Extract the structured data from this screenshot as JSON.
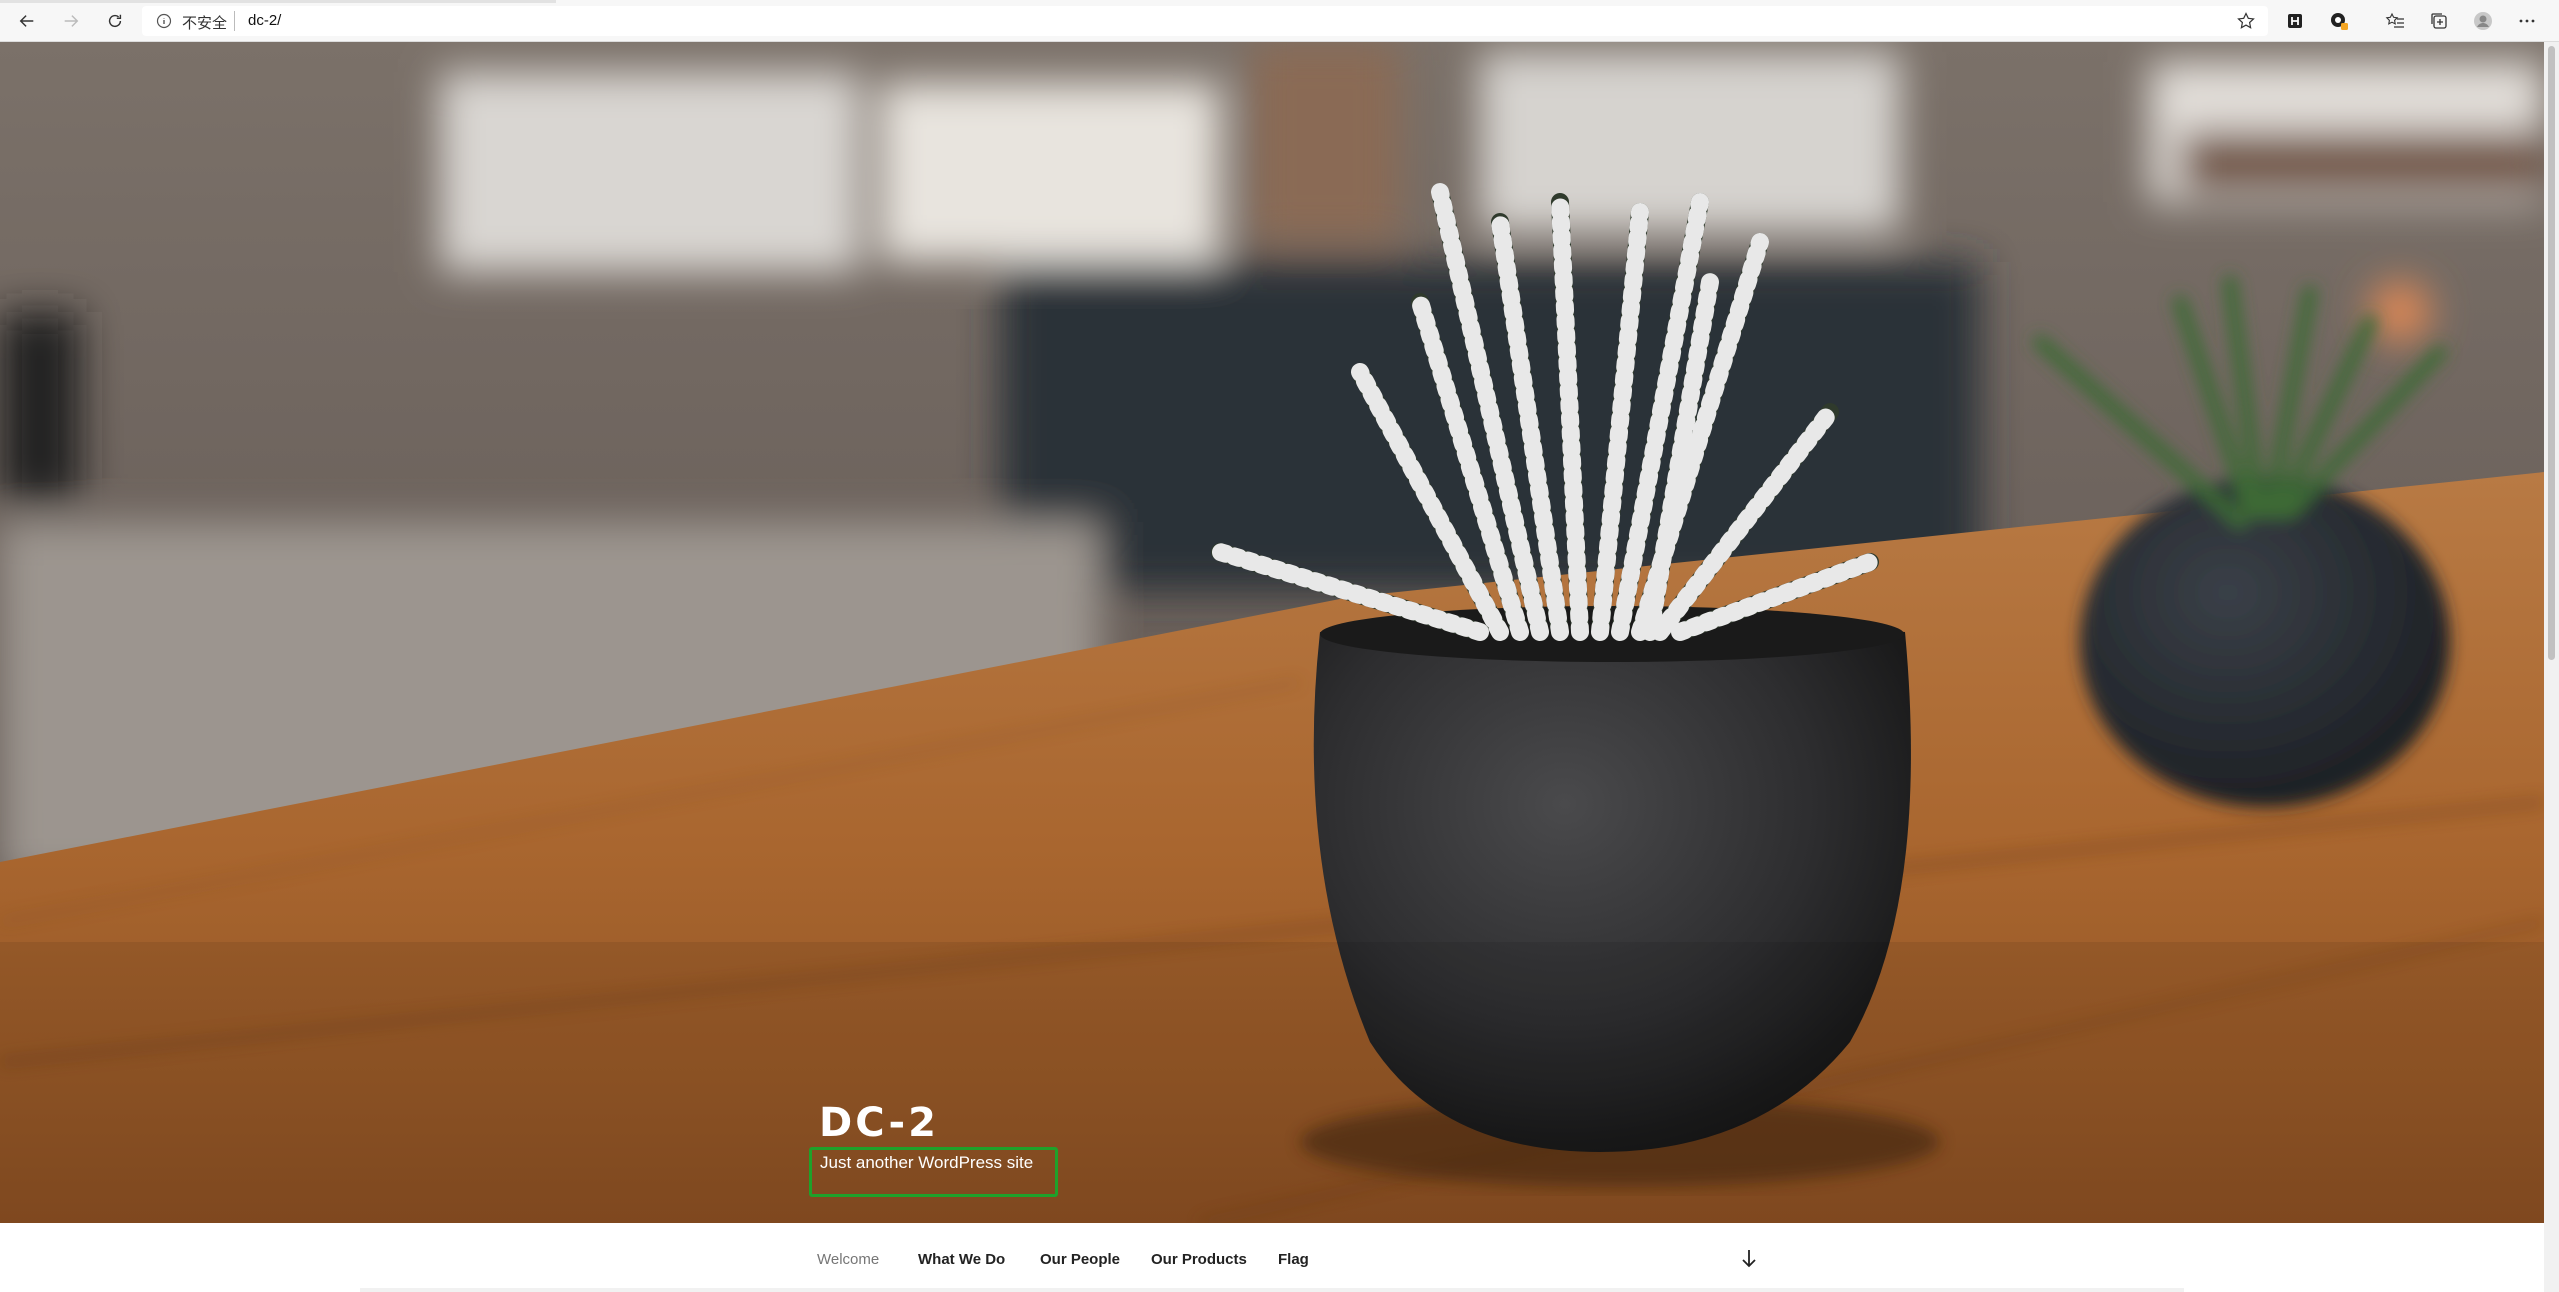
{
  "browser": {
    "security_label": "不安全",
    "url": "dc-2/"
  },
  "site": {
    "title": "DC-2",
    "tagline": "Just another WordPress site"
  },
  "nav": {
    "items": [
      {
        "label": "Welcome"
      },
      {
        "label": "What We Do"
      },
      {
        "label": "Our People"
      },
      {
        "label": "Our Products"
      },
      {
        "label": "Flag"
      }
    ]
  },
  "colors": {
    "highlight_border": "#1fa12a"
  }
}
